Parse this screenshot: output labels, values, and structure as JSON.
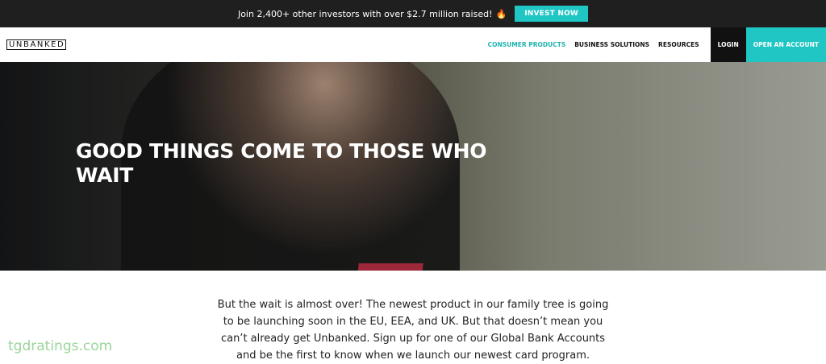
{
  "topbar": {
    "promo": "Join 2,400+ other investors with over $2.7 million raised!",
    "flame": "🔥",
    "invest_label": "INVEST NOW"
  },
  "nav": {
    "logo": "UNBANKED",
    "links": [
      "CONSUMER PRODUCTS",
      "BUSINESS SOLUTIONS",
      "RESOURCES"
    ],
    "login": "LOGIN",
    "open_account": "OPEN AN ACCOUNT"
  },
  "hero": {
    "title": "GOOD THINGS COME TO THOSE WHO WAIT"
  },
  "body": {
    "text": "But the wait is almost over! The newest product in our family tree is going to be launching soon in the EU, EEA, and UK. But that doesn’t mean you can’t already get Unbanked. Sign up for one of our Global Bank Accounts and be the first to know when we launch our newest card program."
  },
  "watermark": "tgdratings.com",
  "colors": {
    "accent": "#1fc6c3",
    "topbar": "#1f1f1f"
  }
}
